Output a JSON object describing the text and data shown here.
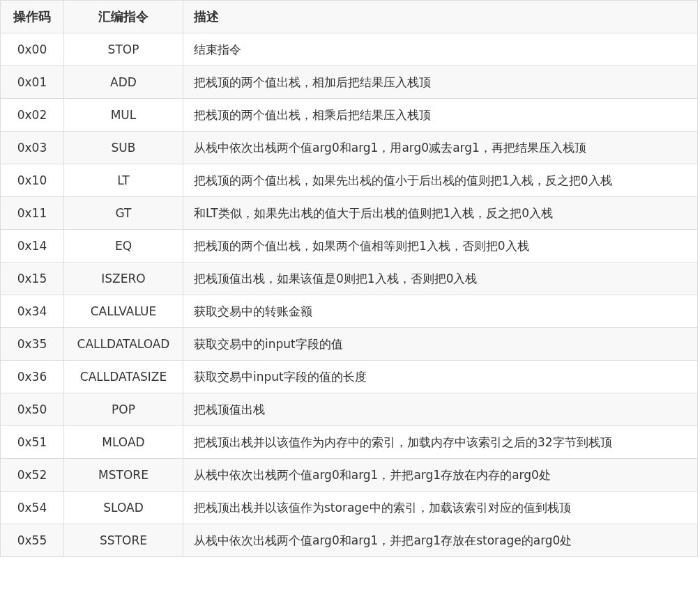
{
  "table": {
    "columns": [
      "操作码",
      "汇编指令",
      "描述"
    ],
    "rows": [
      {
        "opcode": "0x00",
        "mnemonic": "STOP",
        "description": "结束指令"
      },
      {
        "opcode": "0x01",
        "mnemonic": "ADD",
        "description": "把栈顶的两个值出栈，相加后把结果压入栈顶"
      },
      {
        "opcode": "0x02",
        "mnemonic": "MUL",
        "description": "把栈顶的两个值出栈，相乘后把结果压入栈顶"
      },
      {
        "opcode": "0x03",
        "mnemonic": "SUB",
        "description": "从栈中依次出栈两个值arg0和arg1，用arg0减去arg1，再把结果压入栈顶"
      },
      {
        "opcode": "0x10",
        "mnemonic": "LT",
        "description": "把栈顶的两个值出栈，如果先出栈的值小于后出栈的值则把1入栈，反之把0入栈"
      },
      {
        "opcode": "0x11",
        "mnemonic": "GT",
        "description": "和LT类似，如果先出栈的值大于后出栈的值则把1入栈，反之把0入栈"
      },
      {
        "opcode": "0x14",
        "mnemonic": "EQ",
        "description": "把栈顶的两个值出栈，如果两个值相等则把1入栈，否则把0入栈"
      },
      {
        "opcode": "0x15",
        "mnemonic": "ISZERO",
        "description": "把栈顶值出栈，如果该值是0则把1入栈，否则把0入栈"
      },
      {
        "opcode": "0x34",
        "mnemonic": "CALLVALUE",
        "description": "获取交易中的转账金额"
      },
      {
        "opcode": "0x35",
        "mnemonic": "CALLDATALOAD",
        "description": "获取交易中的input字段的值"
      },
      {
        "opcode": "0x36",
        "mnemonic": "CALLDATASIZE",
        "description": "获取交易中input字段的值的长度"
      },
      {
        "opcode": "0x50",
        "mnemonic": "POP",
        "description": "把栈顶值出栈"
      },
      {
        "opcode": "0x51",
        "mnemonic": "MLOAD",
        "description": "把栈顶出栈并以该值作为内存中的索引，加载内存中该索引之后的32字节到栈顶"
      },
      {
        "opcode": "0x52",
        "mnemonic": "MSTORE",
        "description": "从栈中依次出栈两个值arg0和arg1，并把arg1存放在内存的arg0处"
      },
      {
        "opcode": "0x54",
        "mnemonic": "SLOAD",
        "description": "把栈顶出栈并以该值作为storage中的索引，加载该索引对应的值到栈顶"
      },
      {
        "opcode": "0x55",
        "mnemonic": "SSTORE",
        "description": "从栈中依次出栈两个值arg0和arg1，并把arg1存放在storage的arg0处"
      }
    ]
  }
}
